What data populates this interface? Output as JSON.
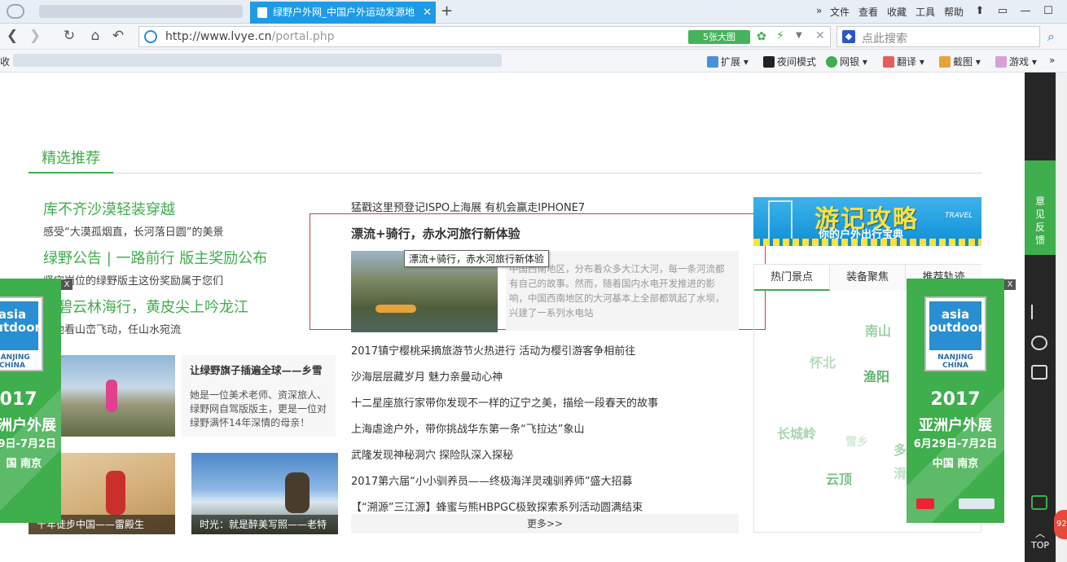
{
  "browser": {
    "tab_title": "绿野户外网_中国户外运动发源地",
    "tab_close": "✕",
    "new_tab": "+",
    "menu": [
      "文件",
      "查看",
      "收藏",
      "工具",
      "帮助"
    ],
    "url_host": "http://www.lvye.cn",
    "url_path": "/portal.php",
    "big_image_badge": "5张大图",
    "search_placeholder": "点此搜索",
    "favorites_fragment": "收",
    "toolbar": [
      "扩展",
      "夜间模式",
      "网银",
      "翻译",
      "截图",
      "游戏"
    ]
  },
  "section": {
    "title": "精选推荐"
  },
  "left": {
    "items": [
      {
        "title": "库不齐沙漠轻装穿越",
        "desc": "感受“大漠孤烟直，长河落日圆”的美景"
      },
      {
        "title": "绿野公告 | 一路前行 版主奖励公布",
        "desc": "坚守岗位的绿野版主这份奖励属于您们"
      },
      {
        "title": "竹碧云林海行，黄皮尖上吟龙江",
        "desc": "静地看山峦飞动，任山水宛流"
      }
    ],
    "story": {
      "title": "让绿野旗子插遍全球——乡雪",
      "desc": "她是一位美术老师、资深旅人、绿野网自驾版版主，更是一位对绿野满怀14年深情的母亲！"
    },
    "captions": [
      "十年徒步中国——雷殿生",
      "时光：就是醉美写照——老特"
    ]
  },
  "middle": {
    "top_link": "猛戳这里预登记ISPO上海展 有机会赢走IPHONE7",
    "featured_title": "漂流+骑行，赤水河旅行新体验",
    "tooltip": "漂流+骑行，赤水河旅行新体验",
    "featured_desc": "中国西南地区，分布着众多大江大河，每一条河流都有自己的故事。然而，随着国内水电开发推进的影响，中国西南地区的大河基本上全部都筑起了水坝，兴建了一系列水电站",
    "links": [
      "2017镇宁樱桃采摘旅游节火热进行 活动为樱引游客争相前往",
      "沙海层层藏岁月 魅力亲曼动心神",
      "十二星座旅行家带你发现不一样的辽宁之美，描绘一段春天的故事",
      "上海虐途户外，带你挑战华东第一条“飞拉达”象山",
      "武隆发现神秘洞穴 探险队深入探秘",
      "2017第六届“小小驯养员——终极海洋灵魂驯养师”盛大招募",
      "【“溯源”三江源】蜂蜜与熊HBPGC极致探索系列活动圆满结束"
    ],
    "more": "更多>>"
  },
  "right": {
    "banner_title": "游记攻略",
    "banner_sub": "你的户外出行宝典",
    "banner_tag": "TRAVEL",
    "tabs": [
      "热门景点",
      "装备聚焦",
      "推荐轨迹"
    ],
    "cloud": [
      "南山",
      "怀北",
      "渔阳",
      "长城岭",
      "雪乡",
      "云顶",
      "多",
      "滑"
    ]
  },
  "ad": {
    "logo_line1": "asia",
    "logo_line2": "outdoor",
    "logo_city": "NANJING CHINA",
    "year": "2017",
    "title": "亚洲户外展",
    "dates": "6月29日-7月2日",
    "place": "中国 南京",
    "close": "X",
    "left_year": "2017",
    "left_title": "洲户外展",
    "left_dates": "9日-7月2日",
    "left_place": "国 南京"
  },
  "sidebar": {
    "feedback": "意见反馈",
    "top": "TOP",
    "badge": "92"
  },
  "colors": {
    "accent": "#3fae4d",
    "tab_blue": "#1e9be6",
    "highlight_box": "#d43c3c"
  }
}
